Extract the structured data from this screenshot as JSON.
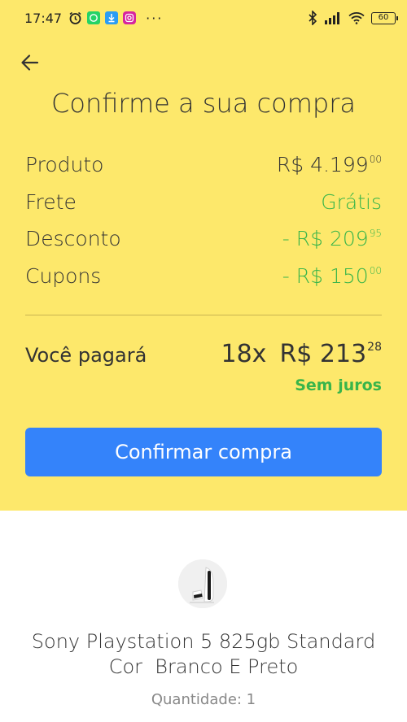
{
  "status_bar": {
    "time": "17:47",
    "battery": "60",
    "more": "···"
  },
  "header": {
    "title": "Confirme a sua compra"
  },
  "summary": {
    "rows": [
      {
        "label": "Produto",
        "value": "R$ 4.199",
        "cents": "00"
      },
      {
        "label": "Frete",
        "value": "Grátis",
        "cents": ""
      },
      {
        "label": "Desconto",
        "value": "- R$ 209",
        "cents": "95"
      },
      {
        "label": "Cupons",
        "value": "- R$ 150",
        "cents": "00"
      }
    ],
    "pay_label": "Você pagará",
    "installments": "18x",
    "installment_value": "R$ 213",
    "installment_cents": "28",
    "interest_note": "Sem juros"
  },
  "actions": {
    "confirm_label": "Confirmar compra"
  },
  "product": {
    "name_line1": "Sony Playstation 5 825gb Standard",
    "name_line2": "Cor  Branco E Preto",
    "quantity": "Quantidade: 1"
  },
  "colors": {
    "background_top": "#fde86b",
    "accent_blue": "#3483fa",
    "positive_green": "#39b54a"
  }
}
